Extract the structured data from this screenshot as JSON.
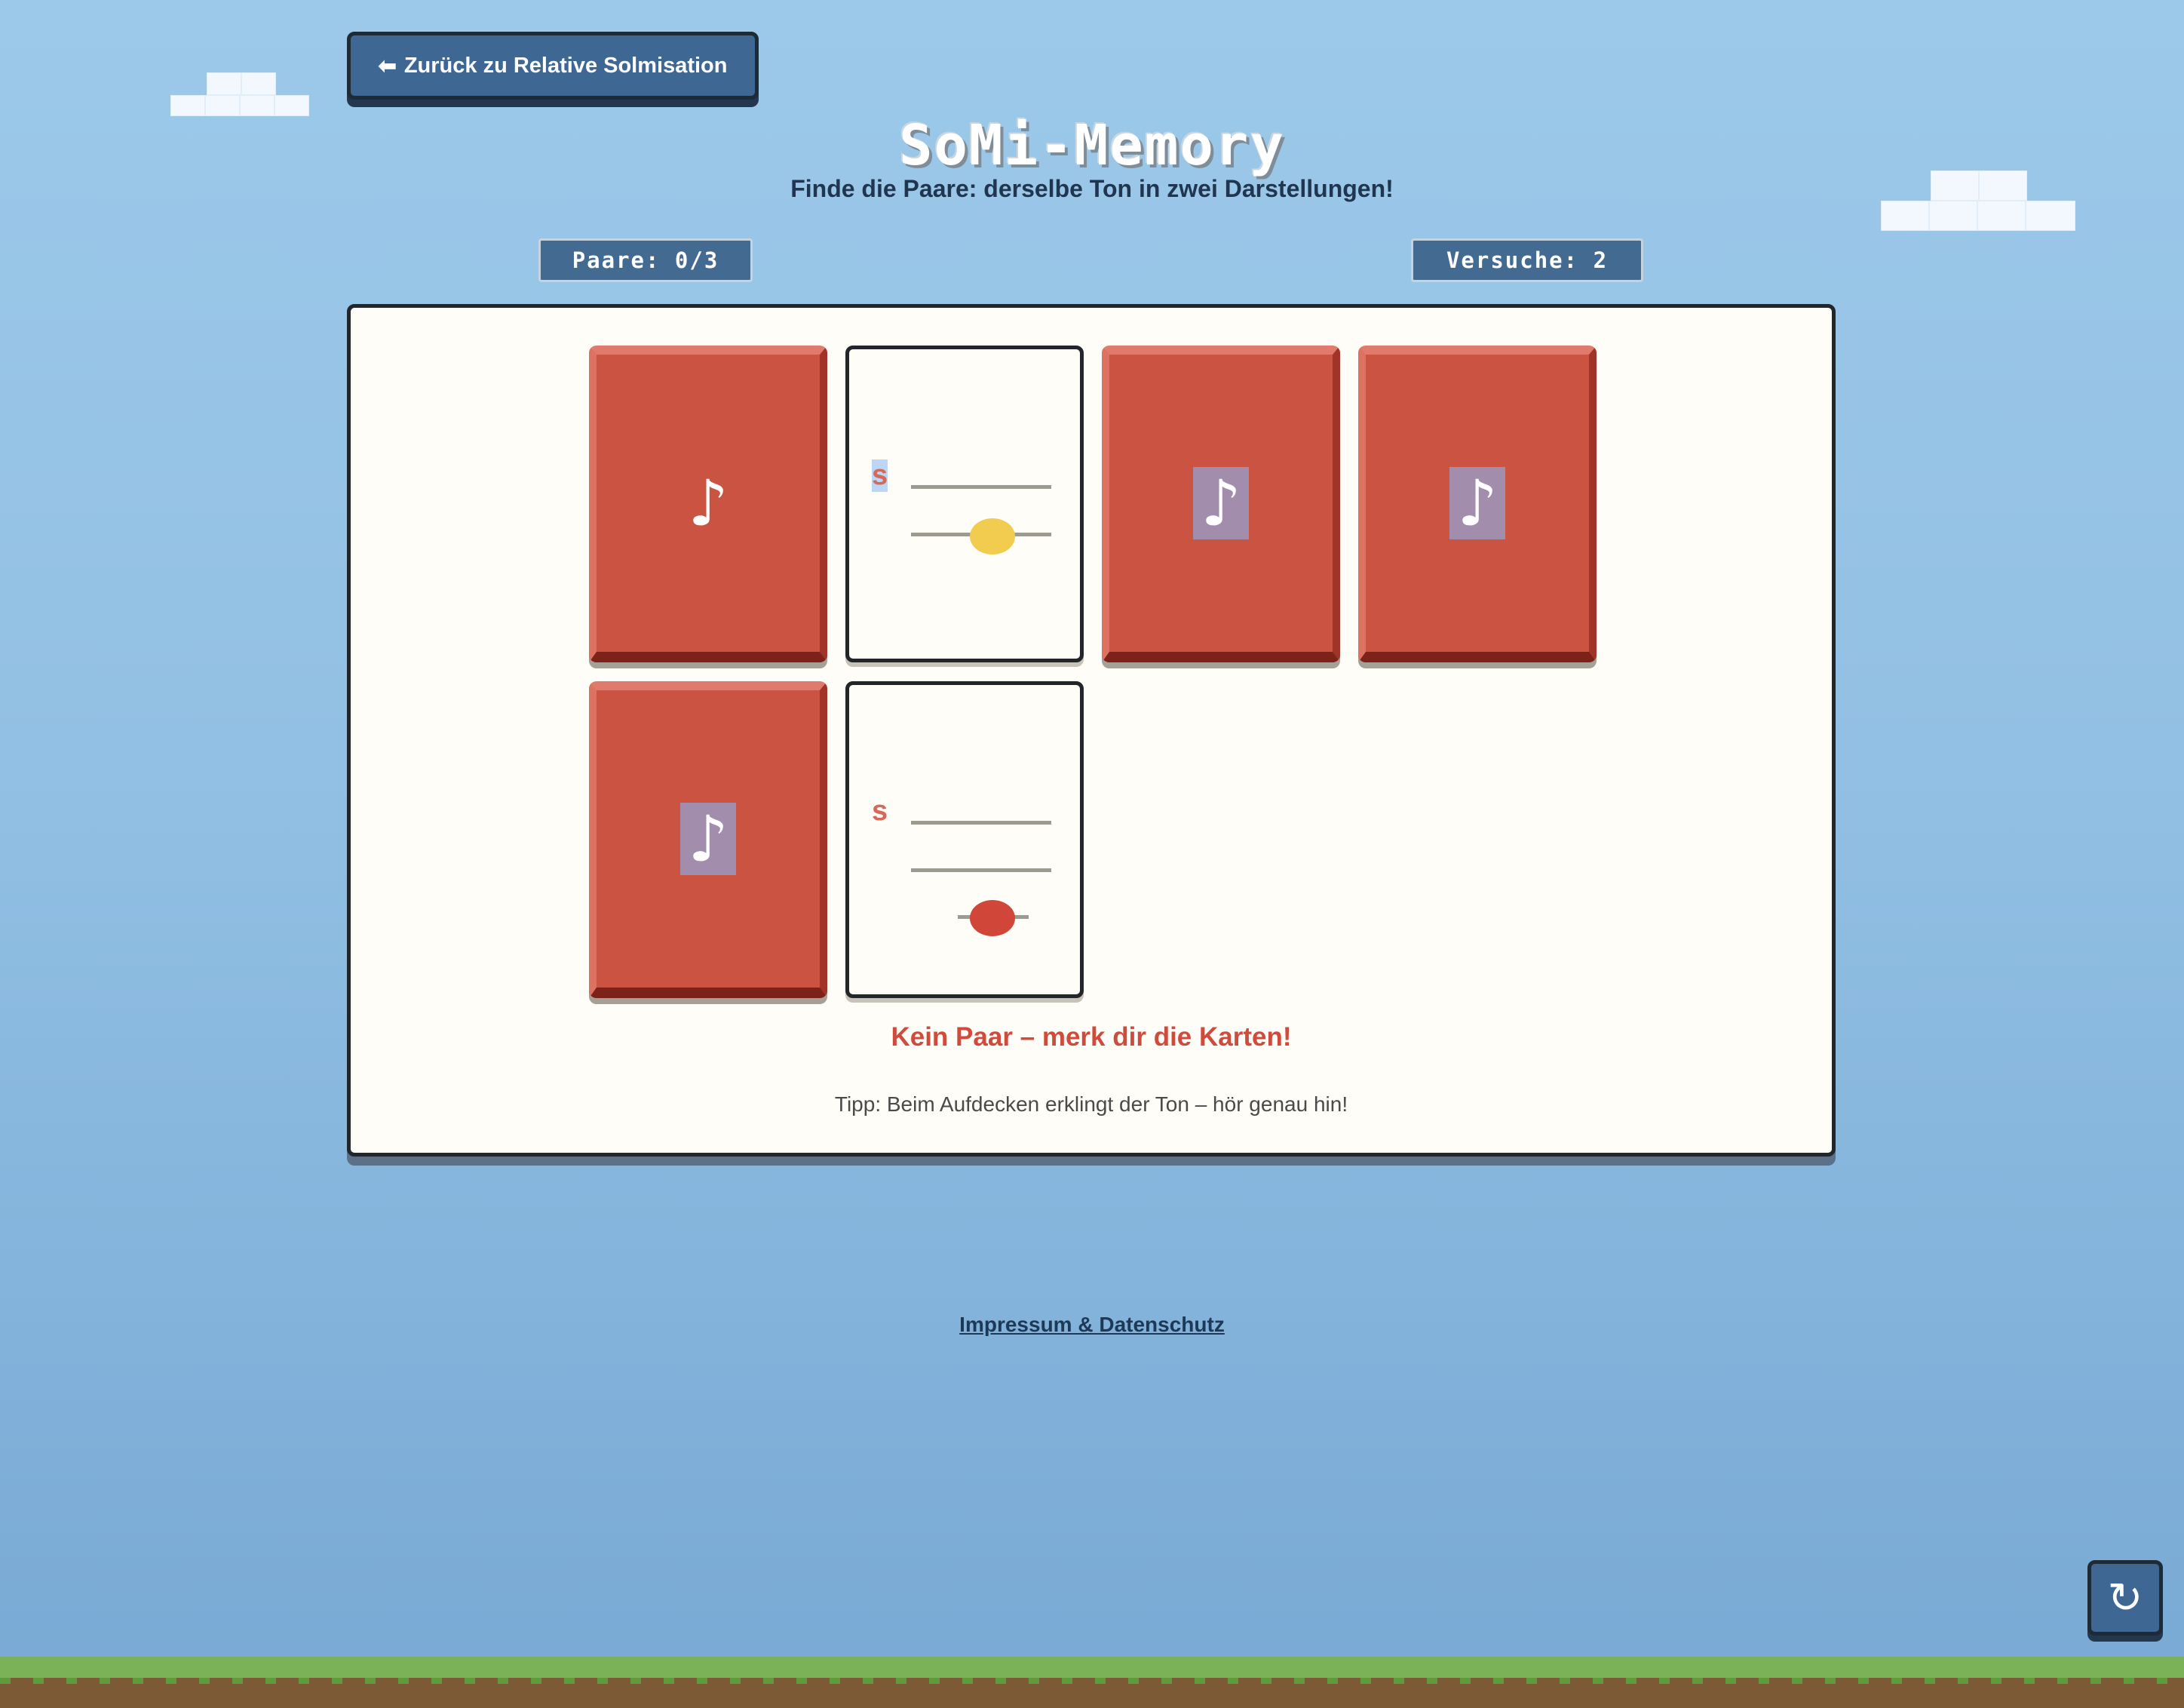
{
  "back_button": {
    "arrow": "⬅",
    "label": "Zurück zu Relative Solmisation"
  },
  "title": "SoMi-Memory",
  "subtitle": "Finde die Paare: derselbe Ton in zwei Darstellungen!",
  "counters": {
    "pairs": "Paare: 0/3",
    "attempts": "Versuche: 2"
  },
  "cards": [
    {
      "state": "face-down",
      "icon": "music-note-icon",
      "glyph": "♪"
    },
    {
      "state": "face-up",
      "syllable": "s",
      "note_color": "#f2cc4e"
    },
    {
      "state": "face-down",
      "icon": "music-note-icon",
      "glyph": "♪"
    },
    {
      "state": "face-down",
      "icon": "music-note-icon",
      "glyph": "♪"
    },
    {
      "state": "face-down",
      "icon": "music-note-icon",
      "glyph": "♪"
    },
    {
      "state": "face-up",
      "syllable": "s",
      "note_color": "#d0473a"
    }
  ],
  "feedback": "Kein Paar – merk dir die Karten!",
  "tip": "Tipp: Beim Aufdecken erklingt der Ton – hör genau hin!",
  "footer_link": "Impressum & Datenschutz",
  "reset_button": {
    "icon": "reload-icon",
    "glyph": "↻"
  },
  "colors": {
    "card_back": "#cb5341",
    "button": "#3e6794",
    "feedback": "#cf4c3c"
  }
}
